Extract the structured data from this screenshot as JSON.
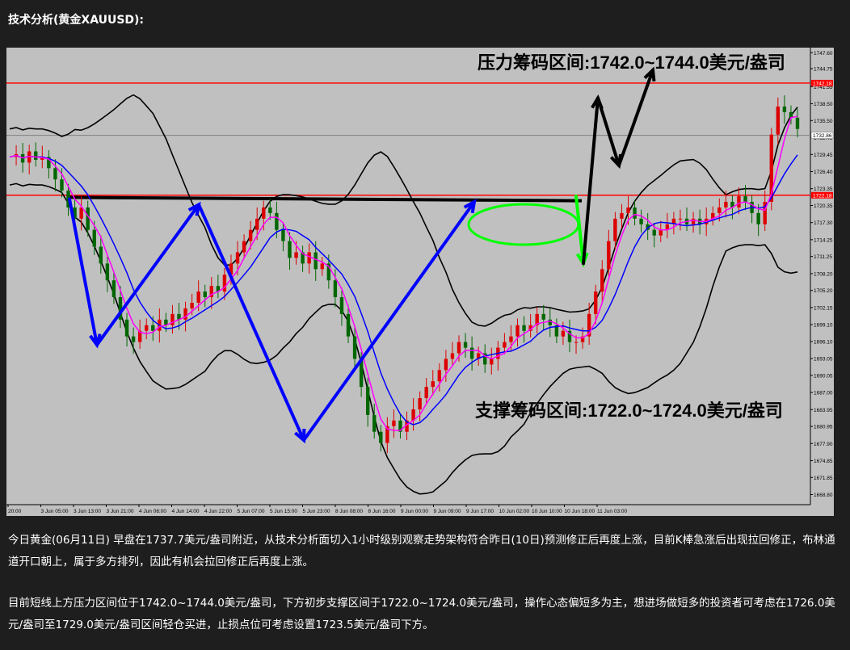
{
  "heading": "技术分析(黄金XAUUSD):",
  "paragraphs": [
    "今日黄金(06月11日) 早盘在1737.7美元/盎司附近，从技术分析面切入1小时级别观察走势架构符合昨日(10日)预测修正后再度上涨，目前K棒急涨后出现拉回修正，布林通道开口朝上，属于多方排列，因此有机会拉回修正后再度上涨。",
    "目前短线上方压力区间位于1742.0~1744.0美元/盎司，下方初步支撑区间于1722.0~1724.0美元/盎司，操作心态偏短多为主，想进场做短多的投资者可考虑在1726.0美元/盎司至1729.0美元/盎司区间轻仓买进，止损点位可考虑设置1723.5美元/盎司下方。"
  ],
  "chart_data": {
    "type": "line",
    "instrument": "XAUUSD",
    "timeframe": "H1",
    "annotations": {
      "resistance": "压力筹码区间:1742.0~1744.0美元/盎司",
      "support": "支撑筹码区间:1722.0~1724.0美元/盎司"
    },
    "ylim": [
      1667.0,
      1748.5
    ],
    "yticks": [
      "1747.60",
      "1744.75",
      "1741.55",
      "1738.50",
      "1735.50",
      "1732.45",
      "1729.45",
      "1726.40",
      "1723.35",
      "1720.35",
      "1717.30",
      "1714.25",
      "1711.25",
      "1708.20",
      "1705.20",
      "1702.15",
      "1699.10",
      "1696.10",
      "1693.05",
      "1690.05",
      "1687.00",
      "1683.95",
      "1680.95",
      "1677.90",
      "1674.85",
      "1671.85",
      "1668.80"
    ],
    "xticks": [
      "20:00",
      "3 Jun 05:00",
      "3 Jun 13:00",
      "3 Jun 21:00",
      "4 Jun 06:00",
      "4 Jun 14:00",
      "4 Jun 22:00",
      "5 Jun 07:00",
      "5 Jun 15:00",
      "5 Jun 23:00",
      "8 Jun 08:00",
      "8 Jun 16:00",
      "9 Jun 00:00",
      "9 Jun 09:00",
      "9 Jun 17:00",
      "10 Jun 02:00",
      "10 Jun 10:00",
      "10 Jun 18:00",
      "11 Jun 03:00"
    ],
    "price_tags": [
      {
        "label": "1742.18",
        "value": 1742.18,
        "color": "#ff0000"
      },
      {
        "label": "1732.86",
        "value": 1732.86,
        "color": "#ffffff"
      },
      {
        "label": "1722.18",
        "value": 1722.18,
        "color": "#ff0000"
      }
    ],
    "horizontal_lines": [
      {
        "value": 1742.18,
        "color": "#ff0000"
      },
      {
        "value": 1722.18,
        "color": "#ff0000"
      },
      {
        "value": 1732.86,
        "color": "#808080"
      }
    ],
    "close_path": [
      1729,
      1729.5,
      1728,
      1730,
      1728.5,
      1729,
      1727,
      1725,
      1723,
      1720,
      1718,
      1720,
      1716,
      1713,
      1710,
      1707,
      1704,
      1700,
      1697,
      1696,
      1698,
      1699,
      1698,
      1700,
      1699,
      1701,
      1700,
      1702,
      1703,
      1705,
      1704,
      1706,
      1705,
      1708,
      1710,
      1712,
      1714,
      1716,
      1718,
      1720,
      1719,
      1716,
      1714,
      1711,
      1712,
      1710,
      1712,
      1709,
      1710,
      1707,
      1704,
      1701,
      1697,
      1693,
      1688,
      1683,
      1680,
      1678,
      1681,
      1682,
      1680,
      1682,
      1684,
      1686,
      1688,
      1689,
      1691,
      1693,
      1694,
      1696,
      1695,
      1693,
      1694,
      1692,
      1693,
      1695,
      1696,
      1697,
      1699,
      1698,
      1699,
      1701,
      1700,
      1699,
      1697,
      1698,
      1696,
      1696,
      1697,
      1701,
      1705,
      1709,
      1714,
      1718,
      1719,
      1720,
      1718,
      1717,
      1716,
      1715,
      1716,
      1717,
      1718,
      1718,
      1717,
      1718,
      1717,
      1718,
      1719,
      1720,
      1721,
      1720,
      1722,
      1721,
      1719,
      1717,
      1721,
      1733,
      1738,
      1737,
      1736,
      1734
    ],
    "series": [
      {
        "color": "#0000ff",
        "role": "slow-ma"
      },
      {
        "color": "#ff00ff",
        "role": "fast-ma"
      },
      {
        "color": "#000000",
        "role": "bollinger-bands"
      }
    ],
    "drawn_arrows": [
      {
        "color": "#0000ff",
        "from": 1721.5,
        "to": 1695.5
      },
      {
        "color": "#0000ff",
        "from": 1695.5,
        "to": 1720.5
      },
      {
        "color": "#0000ff",
        "from": 1720.5,
        "to": 1678.5
      },
      {
        "color": "#0000ff",
        "from": 1678.5,
        "to": 1721.0
      },
      {
        "color": "#00ff00",
        "from": 1722.0,
        "to": 1710.0
      },
      {
        "color": "#000000",
        "from": 1710.0,
        "to": 1739.5
      },
      {
        "color": "#000000",
        "from": 1739.5,
        "to": 1727.5
      },
      {
        "color": "#000000",
        "from": 1727.5,
        "to": 1744.5
      }
    ],
    "grid": false
  }
}
